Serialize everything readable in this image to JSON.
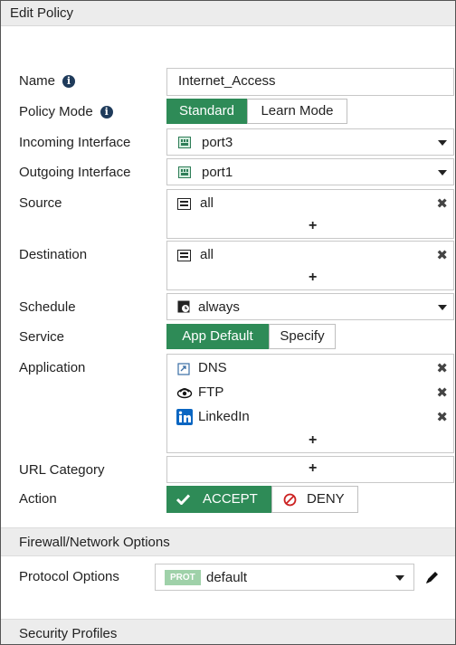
{
  "window": {
    "title": "Edit Policy"
  },
  "form": {
    "name": {
      "label": "Name",
      "value": "Internet_Access"
    },
    "policy_mode": {
      "label": "Policy Mode",
      "options": [
        "Standard",
        "Learn Mode"
      ],
      "selected": "Standard"
    },
    "incoming_interface": {
      "label": "Incoming Interface",
      "value": "port3"
    },
    "outgoing_interface": {
      "label": "Outgoing Interface",
      "value": "port1"
    },
    "source": {
      "label": "Source",
      "items": [
        "all"
      ],
      "add": "+"
    },
    "destination": {
      "label": "Destination",
      "items": [
        "all"
      ],
      "add": "+"
    },
    "schedule": {
      "label": "Schedule",
      "value": "always"
    },
    "service": {
      "label": "Service",
      "options": [
        "App Default",
        "Specify"
      ],
      "selected": "App Default"
    },
    "application": {
      "label": "Application",
      "items": [
        "DNS",
        "FTP",
        "LinkedIn"
      ],
      "add": "+"
    },
    "url_category": {
      "label": "URL Category",
      "add": "+"
    },
    "action": {
      "label": "Action",
      "options": [
        "ACCEPT",
        "DENY"
      ],
      "selected": "ACCEPT"
    }
  },
  "sections": {
    "firewall": "Firewall/Network Options",
    "security": "Security Profiles"
  },
  "protocol_options": {
    "label": "Protocol Options",
    "badge": "PROT",
    "value": "default"
  },
  "colors": {
    "accent": "#2e8b57",
    "deny": "#cc2222",
    "linkedin": "#0a66c2"
  }
}
